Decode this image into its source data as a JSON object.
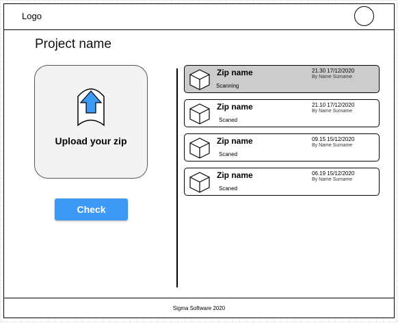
{
  "header": {
    "logo": "Logo",
    "avatar_icon": "user-avatar-circle"
  },
  "main": {
    "project_title": "Project name",
    "upload": {
      "label": "Upload your zip",
      "icon": "upload-arrow-icon",
      "arrow_color": "#3c9af5"
    },
    "check_label": "Check",
    "check_color": "#3c9af5"
  },
  "files": [
    {
      "name": "Zip name",
      "status": "Scanning",
      "time": "21.30 17/12/2020",
      "author": "By Name Surname",
      "active": true,
      "icon": "box-icon"
    },
    {
      "name": "Zip name",
      "status": "Scaned",
      "time": "21.10 17/12/2020",
      "author": "By Name Surname",
      "active": false,
      "icon": "box-icon"
    },
    {
      "name": "Zip name",
      "status": "Scaned",
      "time": "09.15 15/12/2020",
      "author": "By Name Surname",
      "active": false,
      "icon": "box-icon"
    },
    {
      "name": "Zip name",
      "status": "Scaned",
      "time": "06.19 15/12/2020",
      "author": "By Name Surname",
      "active": false,
      "icon": "box-icon"
    }
  ],
  "footer": {
    "text": "Sigma Software 2020"
  }
}
